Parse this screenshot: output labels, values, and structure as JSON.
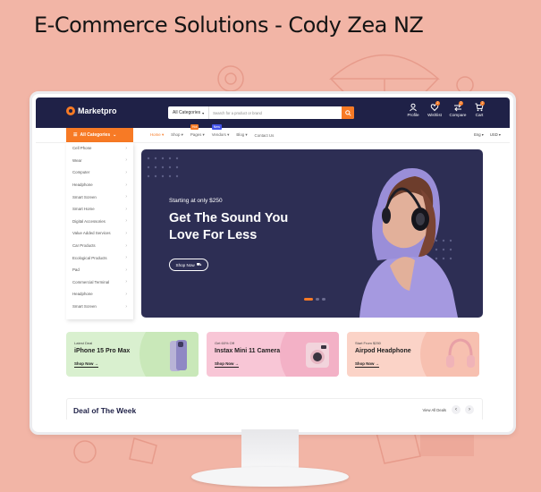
{
  "headline": "E-Commerce Solutions - Cody Zea NZ",
  "brand": {
    "name": "Marketpro",
    "accent": "#f77a25",
    "dark": "#1f2147"
  },
  "search": {
    "category": "All Categories",
    "placeholder": "Search for a product or brand",
    "icon": "search-icon"
  },
  "header_tools": [
    {
      "label": "Profile",
      "icon": "user-icon"
    },
    {
      "label": "Wishlist",
      "icon": "heart-icon",
      "badge": "2"
    },
    {
      "label": "Compare",
      "icon": "compare-icon",
      "badge": "2"
    },
    {
      "label": "Cart",
      "icon": "cart-icon",
      "badge": "2"
    }
  ],
  "nav": {
    "all_categories": "All Categories",
    "links": [
      "Home",
      "Shop",
      "Pages",
      "Vendors",
      "Blog",
      "Contact Us"
    ],
    "tags": {
      "hot": "Hot",
      "new": "New"
    },
    "language": "Eng",
    "currency": "USD"
  },
  "sidebar": {
    "items": [
      "Cell Phone",
      "Wear",
      "Computer",
      "Headphone",
      "Smart Screen",
      "Smart Home",
      "Digital Accessories",
      "Value Added Services",
      "Car Products",
      "Ecological Products",
      "Pad",
      "Commercial Terminal",
      "Headphone",
      "Smart Screen"
    ]
  },
  "hero": {
    "subtitle": "Starting at only $250",
    "title": "Get The Sound You Love For Less",
    "button": "Shop Now"
  },
  "promos": [
    {
      "label": "Latest Deal",
      "title": "iPhone 15 Pro Max",
      "shop": "Shop Now",
      "bg": "#d9f0cf"
    },
    {
      "label": "Get 60% Off",
      "title": "Instax Mini 11 Camera",
      "shop": "Shop Now",
      "bg": "#f8c6d6"
    },
    {
      "label": "Start From $250",
      "title": "Airpod Headphone",
      "shop": "Shop Now",
      "bg": "#fbd3c7"
    }
  ],
  "deal": {
    "title": "Deal of The Week",
    "view_all": "View All Deals"
  }
}
